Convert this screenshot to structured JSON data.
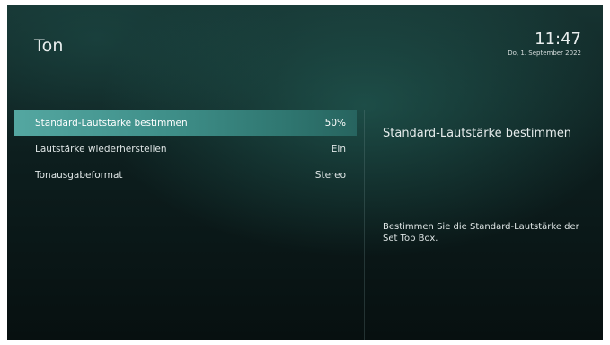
{
  "header": {
    "title": "Ton",
    "time": "11:47",
    "date": "Do, 1. September 2022"
  },
  "settings": [
    {
      "label": "Standard-Lautstärke bestimmen",
      "value": "50%",
      "selected": true
    },
    {
      "label": "Lautstärke wiederherstellen",
      "value": "Ein",
      "selected": false
    },
    {
      "label": "Tonausgabeformat",
      "value": "Stereo",
      "selected": false
    }
  ],
  "info": {
    "title": "Standard-Lautstärke bestimmen",
    "description": "Bestimmen Sie die Standard-Lautstärke der Set Top Box."
  },
  "colors": {
    "highlight": "#4a9e98",
    "background": "#0d1e1e"
  }
}
